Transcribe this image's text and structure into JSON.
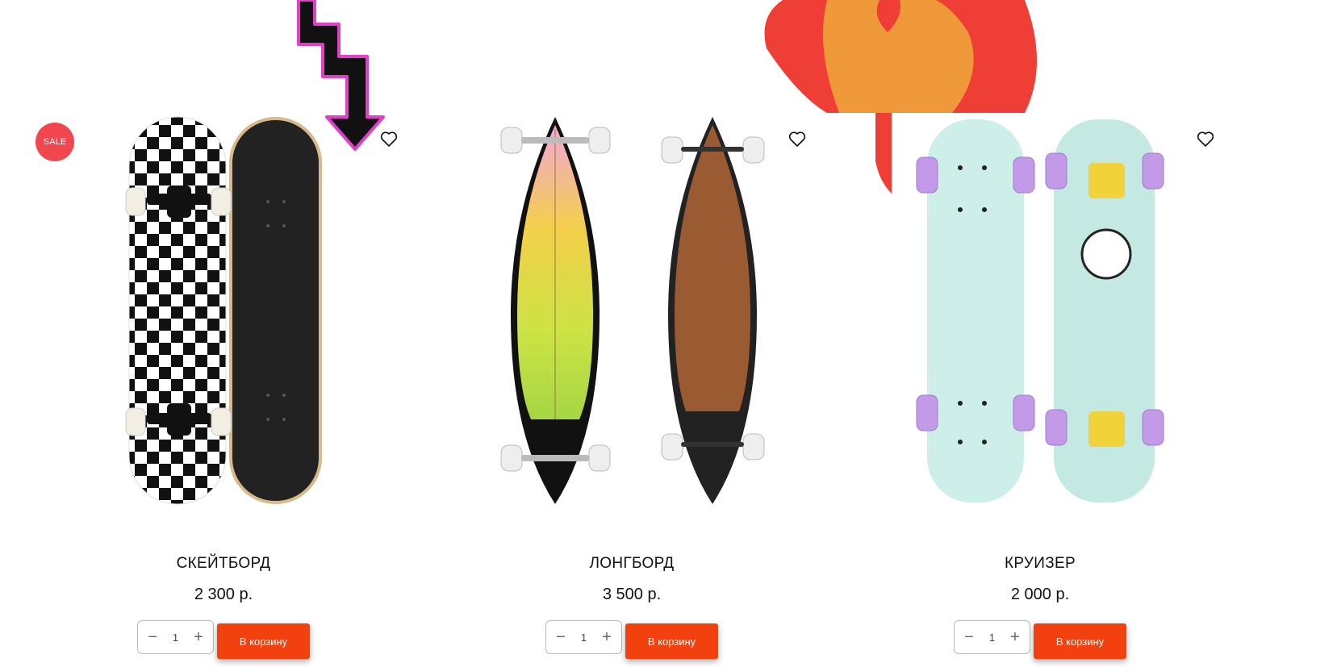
{
  "products": [
    {
      "title": "СКЕЙТБОРД",
      "price": "2 300 р.",
      "badge": "SALE",
      "quantity": "1",
      "cart_label": "В корзину"
    },
    {
      "title": "ЛОНГБОРД",
      "price": "3 500 р.",
      "quantity": "1",
      "cart_label": "В корзину"
    },
    {
      "title": "КРУИЗЕР",
      "price": "2 000 р.",
      "quantity": "1",
      "cart_label": "В корзину"
    }
  ],
  "icons": {
    "favorite": "heart-outline-icon",
    "minus": "minus-icon",
    "plus": "plus-icon",
    "arrow_decoration": "neon-zigzag-arrow",
    "flame_decoration": "flame"
  },
  "colors": {
    "sale_badge": "#f2464e",
    "cart_button": "#f3400f",
    "flame_red": "#ef3e36",
    "flame_orange": "#f0993b",
    "neon_pink": "#e040c8",
    "cruiser_deck": "#cdeee9",
    "cruiser_wheels": "#c39ae8"
  }
}
